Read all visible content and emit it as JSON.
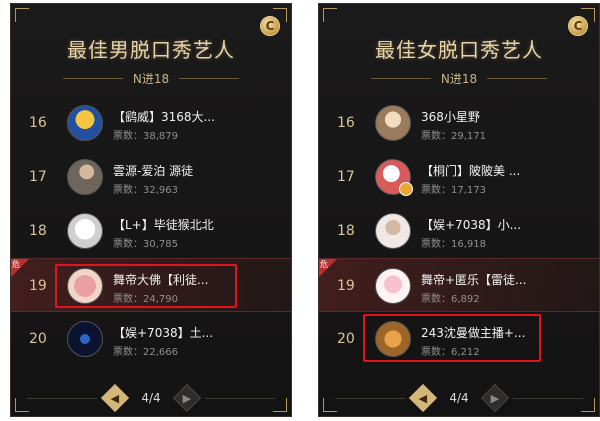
{
  "left": {
    "title": "最佳男脱口秀艺人",
    "subtitle": "N进18",
    "coin_label": "C",
    "rows": [
      {
        "rank": "16",
        "name": "【鹞威】3168大...",
        "votes": "票数：38,879"
      },
      {
        "rank": "17",
        "name": "雲源-爱泊 源徒",
        "votes": "票数：32,963"
      },
      {
        "rank": "18",
        "name": "【L+】毕徒猴北北",
        "votes": "票数：30,785"
      },
      {
        "rank": "19",
        "name": "舞帝大佛【利徒...",
        "votes": "票数：24,790"
      },
      {
        "rank": "20",
        "name": "【娱+7038】土...",
        "votes": "票数：22,666"
      }
    ],
    "danger_label": "危",
    "pager": {
      "page": "4/4",
      "prev": "◀",
      "next": "▶"
    }
  },
  "right": {
    "title": "最佳女脱口秀艺人",
    "subtitle": "N进18",
    "coin_label": "C",
    "rows": [
      {
        "rank": "16",
        "name": "368小星野",
        "votes": "票数：29,171"
      },
      {
        "rank": "17",
        "name": "【桐门】陂陂美 ...",
        "votes": "票数：17,173"
      },
      {
        "rank": "18",
        "name": "【娱+7038】小...",
        "votes": "票数：16,918"
      },
      {
        "rank": "19",
        "name": "舞帝+匿乐【雷徒...",
        "votes": "票数：6,892"
      },
      {
        "rank": "20",
        "name": "243沈曼做主播+...",
        "votes": "票数：6,212"
      }
    ],
    "danger_label": "危",
    "pager": {
      "page": "4/4",
      "prev": "◀",
      "next": "▶"
    }
  },
  "colors": {
    "panel_bg": "#1b1a1a",
    "gold": "#e8d3a6",
    "highlight_red": "#e0141a",
    "danger_red": "#b92d2d"
  }
}
